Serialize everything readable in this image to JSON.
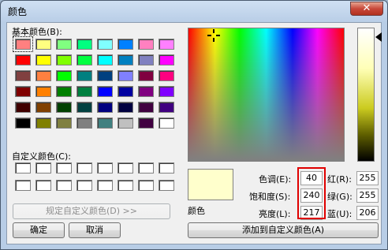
{
  "window": {
    "title": "颜色",
    "close_label": "✕"
  },
  "basic_colors": {
    "label": "基本颜色(B):",
    "swatches": [
      "#ff8080",
      "#ffff80",
      "#80ff80",
      "#00ff80",
      "#80ffff",
      "#0080ff",
      "#ff80c0",
      "#ff80ff",
      "#ff0000",
      "#ffff00",
      "#80ff00",
      "#00ff40",
      "#00ffff",
      "#0080c0",
      "#8080c0",
      "#ff00ff",
      "#804040",
      "#ff8040",
      "#00ff00",
      "#008080",
      "#004080",
      "#8080ff",
      "#800040",
      "#ff0080",
      "#800000",
      "#ff8000",
      "#008000",
      "#008040",
      "#0000ff",
      "#0000a0",
      "#800080",
      "#8000ff",
      "#400000",
      "#804000",
      "#004000",
      "#004040",
      "#000080",
      "#000040",
      "#400040",
      "#400080",
      "#000000",
      "#808000",
      "#808040",
      "#808080",
      "#408080",
      "#c0c0c0",
      "#400040",
      "#ffffff"
    ],
    "selected_index": 0
  },
  "custom_colors": {
    "label": "自定义颜色(C):",
    "count": 16
  },
  "buttons": {
    "define_custom": "规定自定义颜色(D) >>",
    "ok": "确定",
    "cancel": "取消",
    "add_custom": "添加到自定义颜色(A)"
  },
  "preview_label": "颜色",
  "hsl": {
    "hue_label": "色调(E):",
    "hue": "40",
    "sat_label": "饱和度(S):",
    "sat": "240",
    "lum_label": "亮度(L):",
    "lum": "217"
  },
  "rgb": {
    "red_label": "红(R):",
    "red": "255",
    "green_label": "绿(G):",
    "green": "255",
    "blue_label": "蓝(U):",
    "blue": "206"
  },
  "colors": {
    "highlight": "#e00000",
    "current_color": "#ffffcc"
  }
}
